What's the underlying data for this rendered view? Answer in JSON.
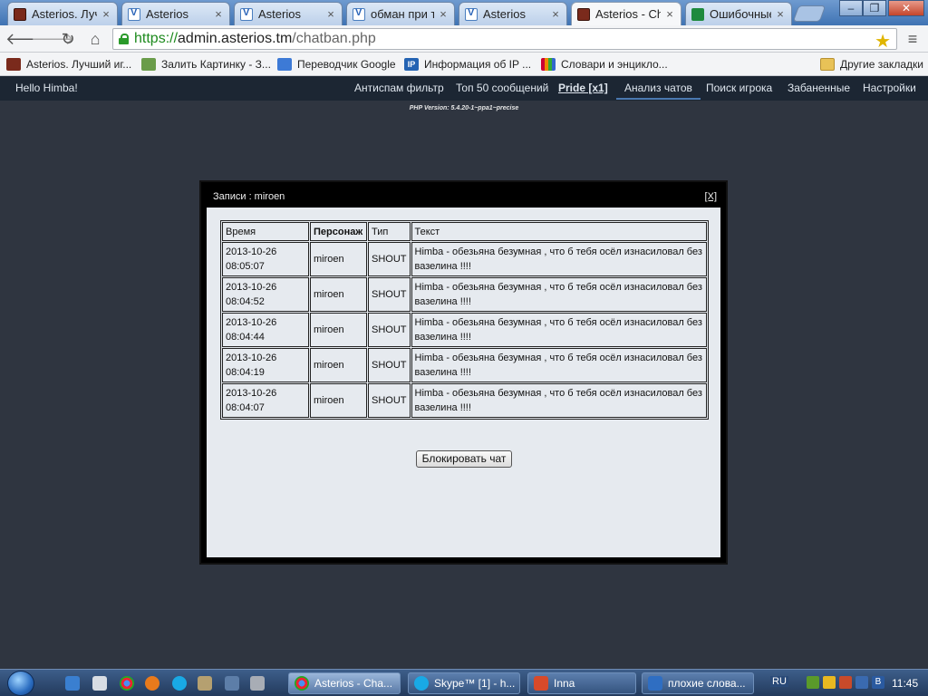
{
  "browser": {
    "tabs": [
      {
        "title": "Asterios. Лучш",
        "icon": "asterios-favicon"
      },
      {
        "title": "Asterios",
        "icon": "v-favicon"
      },
      {
        "title": "Asterios",
        "icon": "v-favicon"
      },
      {
        "title": "обман при т",
        "icon": "v-favicon"
      },
      {
        "title": "Asterios",
        "icon": "v-favicon"
      },
      {
        "title": "Asterios - Cha",
        "icon": "asterios-favicon",
        "active": true
      },
      {
        "title": "Ошибочные",
        "icon": "sheet-favicon"
      }
    ],
    "close_glyph": "×",
    "url_scheme": "https://",
    "url_host": "admin.asterios.tm",
    "url_path": "/chatban.php"
  },
  "bookmarks": [
    {
      "label": "Asterios. Лучший иг...",
      "icon": "asterios-icon"
    },
    {
      "label": "Залить Картинку - З...",
      "icon": "image-upload-icon"
    },
    {
      "label": "Переводчик Google",
      "icon": "translate-icon"
    },
    {
      "label": "Информация об IP ...",
      "icon": "ip-icon"
    },
    {
      "label": "Словари и энцикло...",
      "icon": "dictionary-icon"
    },
    {
      "label": "Другие закладки",
      "icon": "folder-icon"
    }
  ],
  "site": {
    "greeting": "Hello Himba!",
    "nav": [
      {
        "label": "Антиспам фильтр"
      },
      {
        "label": "Топ 50 сообщений"
      },
      {
        "label": "Pride [x1]",
        "bold": true
      },
      {
        "label": "Анализ чатов",
        "active": true
      },
      {
        "label": "Поиск игрока"
      },
      {
        "label": "Забаненные"
      },
      {
        "label": "Настройки"
      }
    ],
    "php_version": "PHP Version: 5.4.20-1~ppa1~precise"
  },
  "modal": {
    "title": "Записи : miroen",
    "close_label": "[X]",
    "columns": [
      "Время",
      "Персонаж",
      "Тип",
      "Текст"
    ],
    "rows": [
      {
        "time": "2013-10-26 08:05:07",
        "character": "miroen",
        "type": "SHOUT",
        "text": "Himba - обезьяна безумная , что б тебя осёл изнасиловал без вазелина !!!!"
      },
      {
        "time": "2013-10-26 08:04:52",
        "character": "miroen",
        "type": "SHOUT",
        "text": "Himba - обезьяна безумная , что б тебя осёл изнасиловал без вазелина !!!!"
      },
      {
        "time": "2013-10-26 08:04:44",
        "character": "miroen",
        "type": "SHOUT",
        "text": "Himba - обезьяна безумная , что б тебя осёл изнасиловал без вазелина !!!!"
      },
      {
        "time": "2013-10-26 08:04:19",
        "character": "miroen",
        "type": "SHOUT",
        "text": "Himba - обезьяна безумная , что б тебя осёл изнасиловал без вазелина !!!!"
      },
      {
        "time": "2013-10-26 08:04:07",
        "character": "miroen",
        "type": "SHOUT",
        "text": "Himba - обезьяна безумная , что б тебя осёл изнасиловал без вазелина !!!!"
      }
    ],
    "block_button": "Блокировать чат"
  },
  "taskbar": {
    "tasks": [
      {
        "label": "Asterios - Cha...",
        "icon": "chrome-icon",
        "active": true
      },
      {
        "label": "Skype™ [1] - h...",
        "icon": "skype-icon"
      },
      {
        "label": "Inna",
        "icon": "player-icon"
      },
      {
        "label": "плохие слова...",
        "icon": "document-icon"
      }
    ],
    "tray_lang": "RU",
    "clock": "11:45"
  }
}
